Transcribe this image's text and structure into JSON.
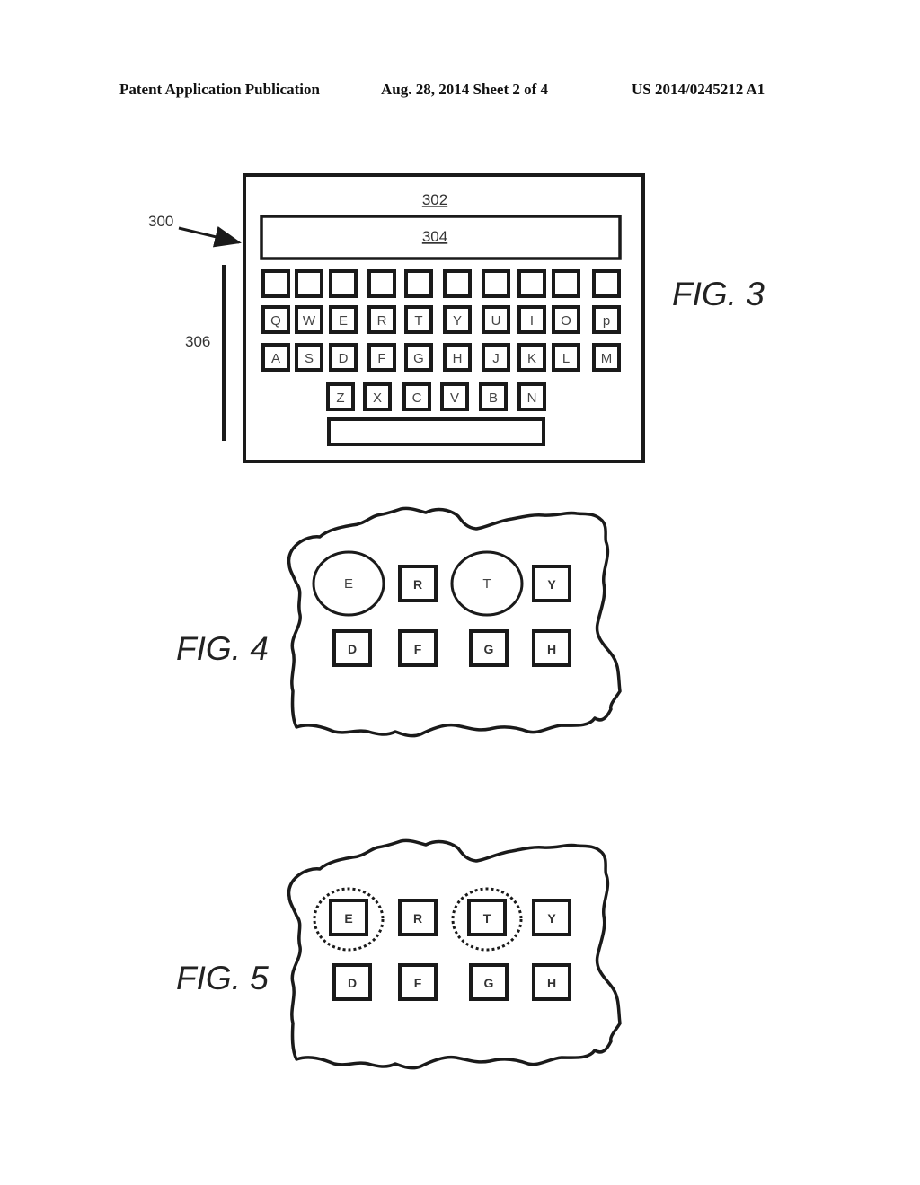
{
  "header": {
    "publication": "Patent Application Publication",
    "date_sheet": "Aug. 28, 2014  Sheet 2 of 4",
    "number": "US 2014/0245212 A1"
  },
  "fig3": {
    "title": "FIG. 3",
    "ref_device": "300",
    "ref_display": "302",
    "ref_text_field": "304",
    "ref_keyboard": "306",
    "row0": [
      "",
      "",
      "",
      "",
      "",
      "",
      "",
      "",
      "",
      ""
    ],
    "row1": [
      "Q",
      "W",
      "E",
      "R",
      "T",
      "Y",
      "U",
      "I",
      "O",
      "p"
    ],
    "row2": [
      "A",
      "S",
      "D",
      "F",
      "G",
      "H",
      "J",
      "K",
      "L",
      "M"
    ],
    "row3": [
      "Z",
      "X",
      "C",
      "V",
      "B",
      "N"
    ]
  },
  "fig4": {
    "title": "FIG. 4",
    "top": [
      "E",
      "R",
      "T",
      "Y"
    ],
    "bottom": [
      "D",
      "F",
      "G",
      "H"
    ],
    "enlarged": [
      "E",
      "T"
    ]
  },
  "fig5": {
    "title": "FIG. 5",
    "top": [
      "E",
      "R",
      "T",
      "Y"
    ],
    "bottom": [
      "D",
      "F",
      "G",
      "H"
    ],
    "highlighted": [
      "E",
      "T"
    ]
  }
}
